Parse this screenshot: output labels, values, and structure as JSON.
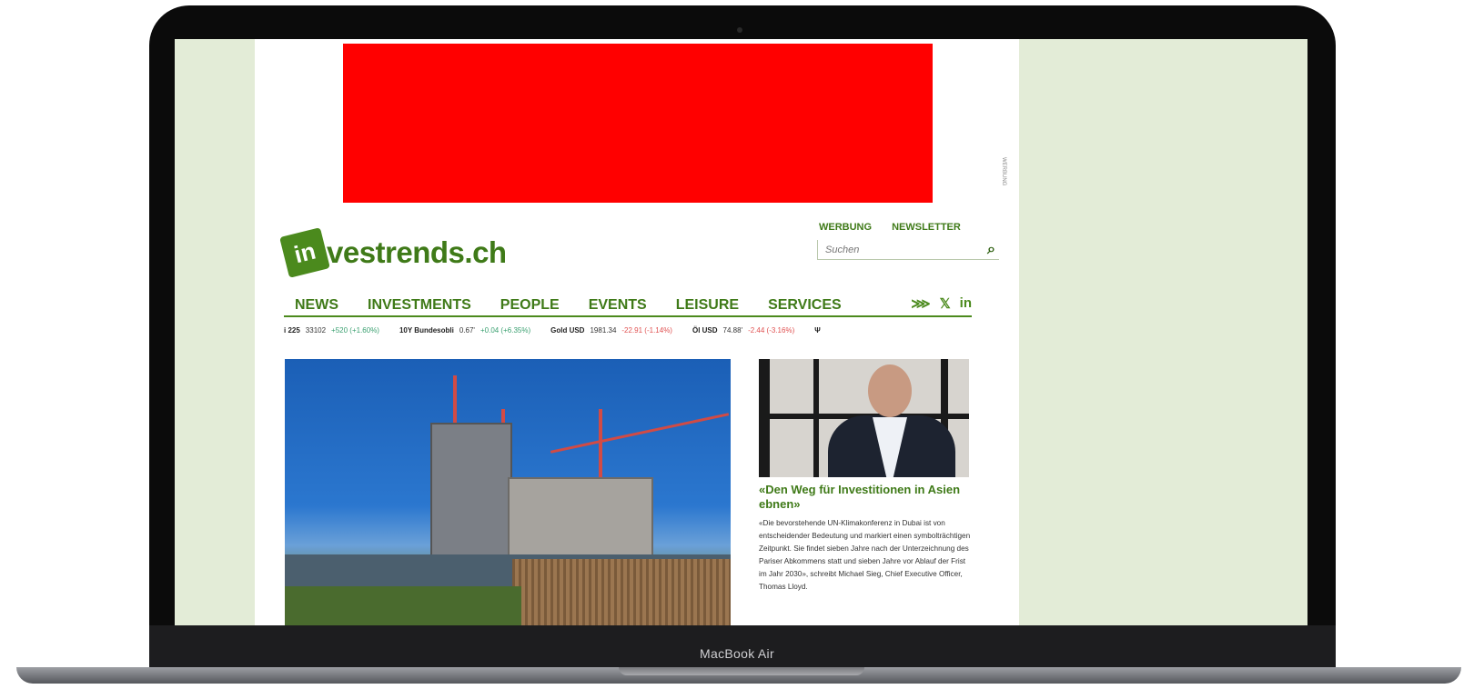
{
  "device": {
    "model_name": "MacBook Air"
  },
  "ad": {
    "label": "WERBUNG"
  },
  "site": {
    "logo_mark": "in",
    "logo_text": "vestrends.ch",
    "colors": {
      "brand_green": "#3f7a18",
      "ad_red": "#ff0000",
      "screen_bg": "#e3ecd7"
    }
  },
  "header": {
    "links": [
      "WERBUNG",
      "NEWSLETTER"
    ],
    "search_placeholder": "Suchen",
    "search_icon": "search-icon"
  },
  "nav": {
    "items": [
      "NEWS",
      "INVESTMENTS",
      "PEOPLE",
      "EVENTS",
      "LEISURE",
      "SERVICES"
    ],
    "social": {
      "rss": "⋙",
      "x": "𝕏",
      "linkedin": "in"
    }
  },
  "ticker": [
    {
      "name": "i 225",
      "value": "33102",
      "change": "+520 (+1.60%)",
      "dir": "up"
    },
    {
      "name": "10Y Bundesobli",
      "value": "0.67'",
      "change": "+0.04 (+6.35%)",
      "dir": "up"
    },
    {
      "name": "Gold USD",
      "value": "1981.34",
      "change": "-22.91 (-1.14%)",
      "dir": "down"
    },
    {
      "name": "Öl USD",
      "value": "74.88'",
      "change": "-2.44 (-3.16%)",
      "dir": "down"
    },
    {
      "name": "Ψ",
      "value": "",
      "change": "",
      "dir": "up"
    }
  ],
  "side_article": {
    "title": "«Den Weg für Investitionen in Asien ebnen»",
    "text": "«Die bevorstehende UN-Klimakonferenz in Dubai ist von entscheidender Bedeutung und markiert einen symbolträchtigen Zeitpunkt. Sie findet sieben Jahre nach der Unterzeichnung des Pariser Abkommens statt und sieben Jahre vor Ablauf der Frist im Jahr 2030», schreibt Michael Sieg, Chief Executive Officer, Thomas Lloyd."
  }
}
